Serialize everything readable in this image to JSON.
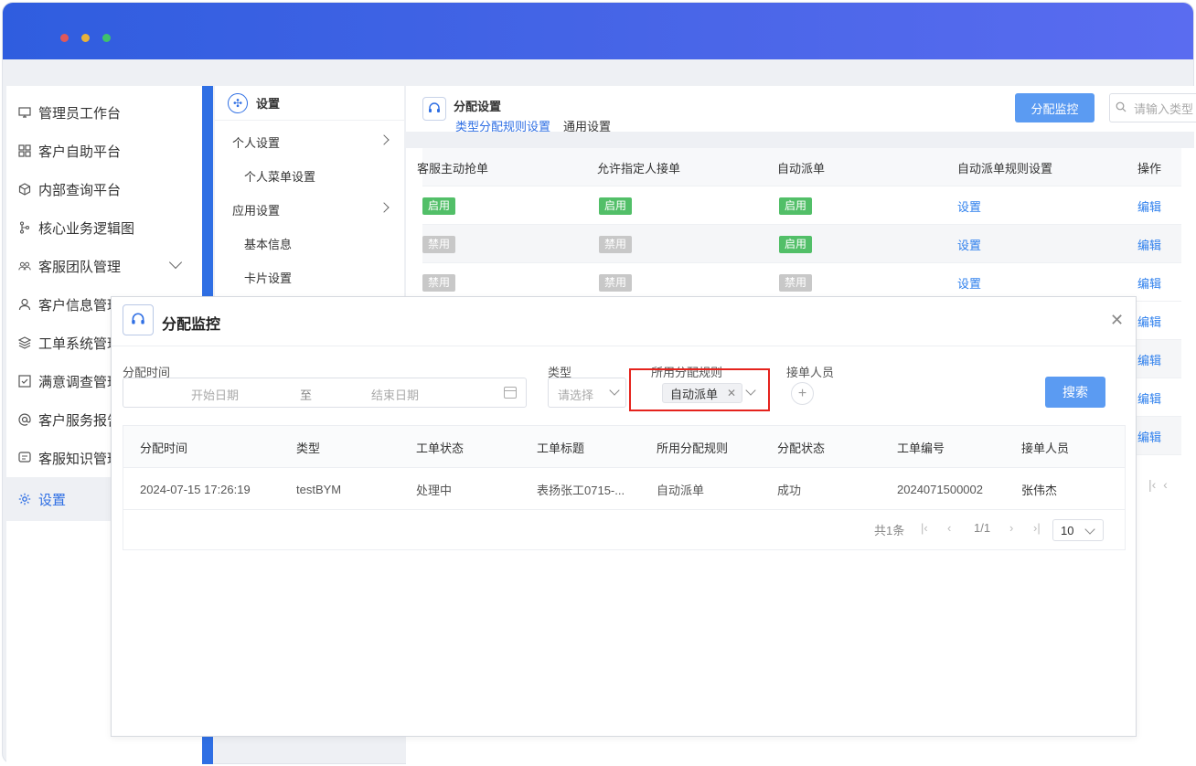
{
  "nav": {
    "items": [
      {
        "label": "管理员工作台",
        "icon": "monitor-icon"
      },
      {
        "label": "客户自助平台",
        "icon": "grid-icon"
      },
      {
        "label": "内部查询平台",
        "icon": "cube-icon"
      },
      {
        "label": "核心业务逻辑图",
        "icon": "branch-icon"
      },
      {
        "label": "客服团队管理",
        "icon": "team-icon"
      },
      {
        "label": "客户信息管理",
        "icon": "user-icon"
      },
      {
        "label": "工单系统管理",
        "icon": "layers-icon"
      },
      {
        "label": "满意调查管理",
        "icon": "checkbox-icon"
      },
      {
        "label": "客户服务报告",
        "icon": "at-icon"
      },
      {
        "label": "客服知识管理",
        "icon": "chat-icon"
      },
      {
        "label": "设置",
        "icon": "gear-icon"
      }
    ]
  },
  "settings_panel": {
    "title": "设置",
    "items": [
      {
        "label": "个人设置"
      },
      {
        "label": "个人菜单设置"
      },
      {
        "label": "应用设置"
      },
      {
        "label": "基本信息"
      },
      {
        "label": "卡片设置"
      }
    ]
  },
  "main": {
    "title": "分配设置",
    "tabs": [
      "类型分配规则设置",
      "通用设置"
    ],
    "monitor_button": "分配监控",
    "search_placeholder": "请输入类型",
    "table": {
      "headers": [
        "客服主动抢单",
        "允许指定人接单",
        "自动派单",
        "自动派单规则设置",
        "操作"
      ],
      "rows": [
        {
          "grab": "启用",
          "assign": "启用",
          "auto": "启用",
          "rule": "设置",
          "op": "编辑"
        },
        {
          "grab": "禁用",
          "assign": "禁用",
          "auto": "启用",
          "rule": "设置",
          "op": "编辑"
        },
        {
          "grab": "禁用",
          "assign": "禁用",
          "auto": "禁用",
          "rule": "设置",
          "op": "编辑"
        }
      ],
      "extra_ops": [
        "编辑",
        "编辑",
        "编辑",
        "编辑"
      ]
    }
  },
  "modal": {
    "title": "分配监控",
    "filters": {
      "time_label": "分配时间",
      "start_placeholder": "开始日期",
      "range_sep": "至",
      "end_placeholder": "结束日期",
      "type_label": "类型",
      "type_placeholder": "请选择",
      "rule_label": "所用分配规则",
      "rule_value": "自动派单",
      "assignee_label": "接单人员"
    },
    "search_button": "搜索",
    "table": {
      "headers": [
        "分配时间",
        "类型",
        "工单状态",
        "工单标题",
        "所用分配规则",
        "分配状态",
        "工单编号",
        "接单人员"
      ],
      "rows": [
        [
          "2024-07-15 17:26:19",
          "testBYM",
          "处理中",
          "表扬张工0715-...",
          "自动派单",
          "成功",
          "2024071500002",
          "张伟杰"
        ]
      ]
    },
    "pagination": {
      "total": "共1条",
      "page": "1/1",
      "page_size": "10"
    }
  }
}
